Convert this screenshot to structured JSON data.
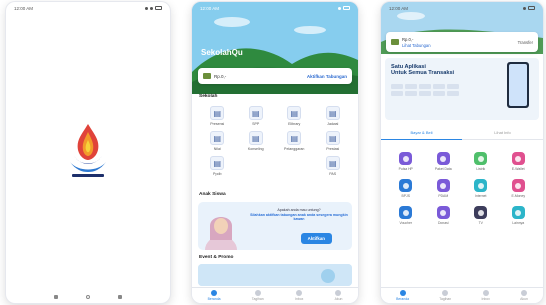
{
  "screens": {
    "splash": {
      "status": {
        "time": "12:00 AM",
        "icons": "sig-wifi-batt"
      }
    },
    "home": {
      "status": {
        "time": "12:00 AM",
        "icons": "sig-wifi-batt"
      },
      "brand": "SekolahQu",
      "balance": {
        "amount": "Rp.0,-",
        "activate_label": "Aktifkan Tabungan"
      },
      "section_school": "Sekolah",
      "menu": [
        {
          "label": "Presensi",
          "icon": "clipboard-icon"
        },
        {
          "label": "SPP",
          "icon": "users-icon"
        },
        {
          "label": "Elibrary",
          "icon": "book-icon"
        },
        {
          "label": "Jadwal",
          "icon": "person-icon"
        },
        {
          "label": "Nilai",
          "icon": "grade-icon"
        },
        {
          "label": "Konseling",
          "icon": "counsel-icon"
        },
        {
          "label": "Pelanggaran",
          "icon": "warning-icon"
        },
        {
          "label": "Prestasi",
          "icon": "trophy-icon"
        },
        {
          "label": "Ppdb",
          "icon": "student-icon"
        },
        {
          "label": "",
          "icon": "blank"
        },
        {
          "label": "",
          "icon": "blank"
        },
        {
          "label": "PAS",
          "icon": "exam-icon"
        }
      ],
      "section_kids": "Anak Siswa",
      "banner": {
        "question": "Apakah anda mau untung?",
        "cta_text": "Silahkan aktifkan tabungan anak anda sesegera mungkin kawan",
        "button_label": "Aktifkan"
      },
      "section_event": "Event & Promo",
      "tabs": [
        "Beranda",
        "Tagihan",
        "Inbox",
        "Akun"
      ]
    },
    "wallet": {
      "status": {
        "time": "12:00 AM",
        "icons": "sig-wifi-batt"
      },
      "card": {
        "amount": "Rp.0,-",
        "link": "Lihat Tabungan",
        "right_label": "Transfer"
      },
      "promo_title_1": "Satu Aplikasi",
      "promo_title_2": "Untuk Semua Transaksi",
      "tabs": [
        "Bayar & Beli",
        "Lihat Info"
      ],
      "services": [
        {
          "label": "Pulsa HP",
          "color": "#7a5ad8"
        },
        {
          "label": "Paket Data",
          "color": "#7a5ad8"
        },
        {
          "label": "Listrik",
          "color": "#4fbf6b"
        },
        {
          "label": "E-Wallet",
          "color": "#e0508f"
        },
        {
          "label": "BPJS",
          "color": "#2b7ad6"
        },
        {
          "label": "PDAM",
          "color": "#7a5ad8"
        },
        {
          "label": "Internet",
          "color": "#2cb5c9"
        },
        {
          "label": "E-Money",
          "color": "#e0508f"
        },
        {
          "label": "Voucher",
          "color": "#2b7ad6"
        },
        {
          "label": "Donasi",
          "color": "#7a5ad8"
        },
        {
          "label": "TV",
          "color": "#3d3d5c"
        },
        {
          "label": "Lainnya",
          "color": "#2cb5c9"
        }
      ],
      "bottom_tabs": [
        "Beranda",
        "Tagihan",
        "Inbox",
        "Akun"
      ]
    }
  }
}
